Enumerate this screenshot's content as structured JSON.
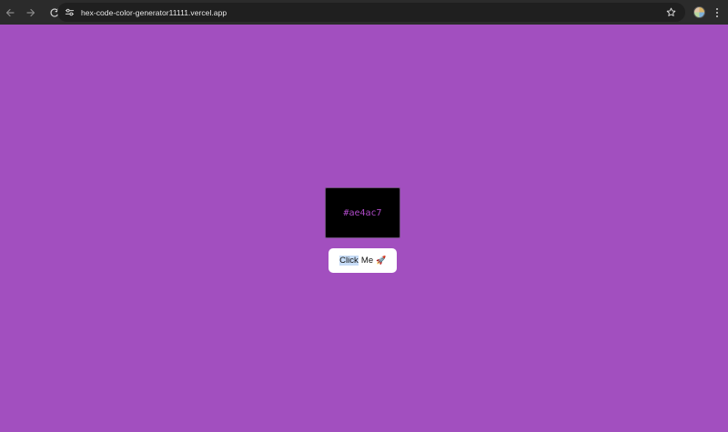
{
  "browser": {
    "url": "hex-code-color-generator11111.vercel.app",
    "icons": {
      "back": "arrow-left-icon",
      "forward": "arrow-right-icon",
      "reload": "reload-icon",
      "site_info": "tune-icon",
      "bookmark": "star-icon",
      "profile": "avatar",
      "menu": "kebab-menu-icon"
    }
  },
  "page": {
    "background_color": "#a24fbf",
    "color_box": {
      "hex_code": "#ae4ac7",
      "box_color": "#000000"
    },
    "button": {
      "label_selected": "Click",
      "label_rest": " Me",
      "emoji": "🚀"
    }
  }
}
